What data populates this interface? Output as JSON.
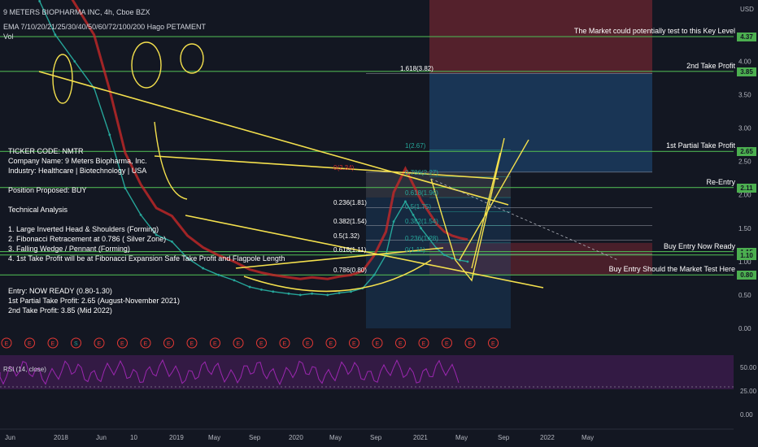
{
  "chart_data": {
    "type": "line",
    "title": "9 METERS BIOPHARMA INC, 4h, Cboe BZX",
    "subtitle": "EMA 7/10/20/21/25/30/40/50/60/72/100/200 Hago PETAMENT",
    "volume_label": "Vol",
    "currency": "USD",
    "y_ticks": [
      "4.00",
      "3.50",
      "3.00",
      "2.50",
      "2.00",
      "1.50",
      "1.00",
      "0.50",
      "0.00"
    ],
    "rsi_ticks": [
      "50.00",
      "25.00",
      "0.00"
    ],
    "rsi_label": "RSI (14, close)",
    "x_ticks": [
      "Jun",
      "2018",
      "Jun",
      "10",
      "2019",
      "May",
      "Sep",
      "2020",
      "May",
      "Sep",
      "2021",
      "May",
      "Sep",
      "2022",
      "May"
    ],
    "price_series": {
      "name": "NMTR",
      "x": [
        0.0,
        0.3,
        0.6,
        1.0,
        1.5,
        2.0,
        2.4,
        2.8,
        3.2,
        3.6,
        4.0,
        4.4,
        4.8,
        5.2,
        5.6,
        6.0,
        6.3,
        6.6,
        7.0,
        7.3,
        7.6,
        8.0,
        8.3,
        8.6,
        8.9,
        9.2,
        9.5,
        9.7,
        10.0,
        10.2,
        10.4,
        10.6,
        10.8,
        11.0,
        11.2,
        11.4,
        11.6
      ],
      "y": [
        5.5,
        5.3,
        4.9,
        4.4,
        4.0,
        3.6,
        2.9,
        2.1,
        1.7,
        1.4,
        1.3,
        1.05,
        0.9,
        0.8,
        0.72,
        0.62,
        0.58,
        0.55,
        0.52,
        0.5,
        0.52,
        0.5,
        0.53,
        0.55,
        0.6,
        0.8,
        1.1,
        1.6,
        1.9,
        1.7,
        1.5,
        1.35,
        1.2,
        1.1,
        1.05,
        1.02,
        1.0
      ]
    },
    "fib_retracement": [
      {
        "label": "1(2.67)",
        "value": 2.67
      },
      {
        "label": "0.786(2.27)",
        "value": 2.27
      },
      {
        "label": "0.618(1.96)",
        "value": 1.96
      },
      {
        "label": "0.5(1.75)",
        "value": 1.75
      },
      {
        "label": "0.382(1.54)",
        "value": 1.54
      },
      {
        "label": "0.236(1.28)",
        "value": 1.28
      },
      {
        "label": "0(1.11)",
        "value": 1.11
      }
    ],
    "fib_extension": [
      {
        "label": "1.618(3.82)",
        "value": 3.82
      },
      {
        "label": "0(2.34)",
        "value": 2.34
      },
      {
        "label": "0.236(1.81)",
        "value": 1.81
      },
      {
        "label": "0.382(1.54)",
        "value": 1.54
      },
      {
        "label": "0.5(1.32)",
        "value": 1.32
      },
      {
        "label": "0.618(1.11)",
        "value": 1.11
      },
      {
        "label": "0.786(0.80)",
        "value": 0.8
      }
    ]
  },
  "levels": [
    {
      "label": "The Market could potentially test to this Key Level",
      "price": "4.37",
      "value": 4.37
    },
    {
      "label": "2nd Take Profit",
      "price": "3.85",
      "value": 3.85
    },
    {
      "label": "1st Partial Take Profit",
      "price": "2.65",
      "value": 2.65
    },
    {
      "label": "Re-Entry",
      "price": "2.11",
      "value": 2.11
    },
    {
      "label": "Buy Entry Now Ready",
      "price": "1.15",
      "value": 1.15
    },
    {
      "label": "",
      "price": "1.10",
      "value": 1.1
    },
    {
      "label": "Buy Entry Should the Market Test Here",
      "price": "0.80",
      "value": 0.8
    }
  ],
  "notes": [
    "TICKER CODE: NMTR",
    "Company Name: 9 Meters Biopharma, Inc.",
    "Industry: Healthcare | Biotechnology | USA",
    "",
    "Position Proposed: BUY",
    "",
    "Technical Analysis",
    "",
    "1. Large Inverted Head & Shoulders (Forming)",
    "2. Fibonacci Retracement at 0.786 ( Silver Zone)",
    "3. Falling Wedge / Pennant (Forming)",
    "4. 1st Take Profit will be at Fibonacci Expansion Safe Take Profit and Flagpole Length",
    "",
    "Entry: NOW READY (0.80-1.30)",
    "1st Partial Take Profit: 2.65 (August-November 2021)",
    "2nd Take Profit: 3.85 (Mid 2022)"
  ],
  "events": [
    "E",
    "E",
    "E",
    "S",
    "E",
    "E",
    "E",
    "E",
    "E",
    "E",
    "E",
    "E",
    "E",
    "E",
    "E",
    "E",
    "E",
    "E",
    "E",
    "E",
    "E",
    "E"
  ],
  "colors": {
    "background": "#131722",
    "level_line": "#4caf50",
    "trend": "#f4e04d",
    "rsi": "#9c27b0",
    "event": "#e53935",
    "fib_label": "#26a69a"
  }
}
